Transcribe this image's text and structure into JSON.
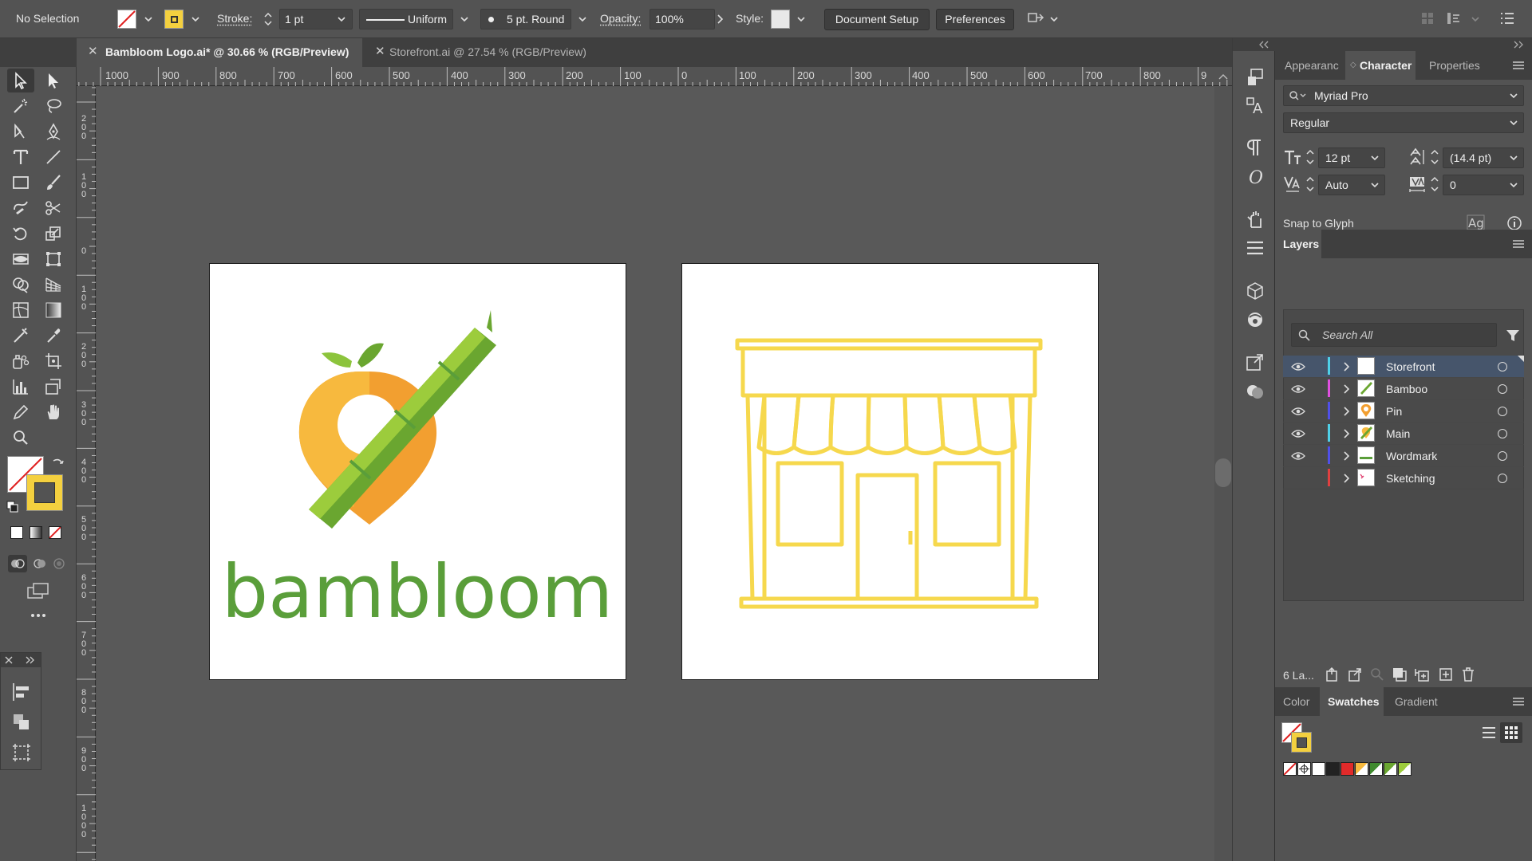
{
  "control_bar": {
    "selection": "No Selection",
    "stroke_label": "Stroke:",
    "stroke_weight": "1 pt",
    "stroke_profile": "Uniform",
    "brush": "5 pt. Round",
    "opacity_label": "Opacity:",
    "opacity": "100%",
    "style_label": "Style:",
    "document_setup": "Document Setup",
    "preferences": "Preferences",
    "fill_color": "#ffffff",
    "stroke_color": "#f4d03f"
  },
  "tabs": [
    {
      "title": "Bambloom Logo.ai* @ 30.66 % (RGB/Preview)",
      "active": true
    },
    {
      "title": "Storefront.ai @ 27.54 % (RGB/Preview)",
      "active": false
    }
  ],
  "rulers": {
    "horizontal": [
      "1000",
      "900",
      "800",
      "700",
      "600",
      "500",
      "400",
      "300",
      "200",
      "100",
      "0",
      "100",
      "200",
      "300",
      "400",
      "500",
      "600",
      "700",
      "800",
      "9"
    ],
    "vertical": [
      "200",
      "100",
      "0",
      "100",
      "200",
      "300",
      "400",
      "500",
      "600",
      "700",
      "800",
      "900",
      "1000"
    ]
  },
  "artboards": {
    "logo_wordmark": "bambloom",
    "colors": {
      "green": "#5a9e3a",
      "bamboo_light": "#9ccc3c",
      "bamboo_dark": "#6aa630",
      "pin_light": "#f7b93e",
      "pin_dark": "#f29f30",
      "storefront": "#f6d84d"
    }
  },
  "character_panel": {
    "tabs": [
      "Appearanc",
      "Character",
      "Properties"
    ],
    "font_family": "Myriad Pro",
    "font_style": "Regular",
    "font_size": "12 pt",
    "leading": "(14.4 pt)",
    "kerning": "Auto",
    "tracking": "0",
    "snap_to_glyph": "Snap to Glyph"
  },
  "layers_panel": {
    "title": "Layers",
    "search_placeholder": "Search All",
    "count": "6 La...",
    "layers": [
      {
        "name": "Storefront",
        "color": "#4fd0e8",
        "visible": true,
        "selected": true
      },
      {
        "name": "Bamboo",
        "color": "#e050e0",
        "visible": true,
        "selected": false
      },
      {
        "name": "Pin",
        "color": "#5050e8",
        "visible": true,
        "selected": false
      },
      {
        "name": "Main",
        "color": "#4fd0e8",
        "visible": true,
        "selected": false
      },
      {
        "name": "Wordmark",
        "color": "#5050e8",
        "visible": true,
        "selected": false
      },
      {
        "name": "Sketching",
        "color": "#e04040",
        "visible": false,
        "selected": false
      }
    ]
  },
  "swatches_panel": {
    "tabs": [
      "Color",
      "Swatches",
      "Gradient"
    ]
  }
}
